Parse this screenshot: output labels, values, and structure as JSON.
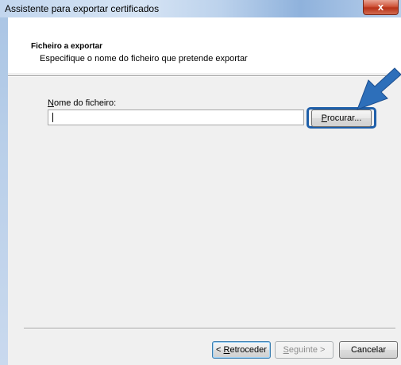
{
  "window": {
    "title": "Assistente para exportar certificados",
    "close_label": "x"
  },
  "header": {
    "title": "Ficheiro a exportar",
    "subtitle": "Especifique o nome do ficheiro que pretende exportar"
  },
  "form": {
    "filename_label_accesskey": "N",
    "filename_label_rest": "ome do ficheiro:",
    "filename_value": "",
    "browse_accesskey": "P",
    "browse_rest": "rocurar..."
  },
  "footer": {
    "back_prefix": "< ",
    "back_accesskey": "R",
    "back_rest": "etroceder",
    "next_accesskey": "S",
    "next_rest": "eguinte >",
    "cancel_label": "Cancelar"
  },
  "colors": {
    "accent": "#1f5fa9",
    "arrow": "#2d6fba",
    "close_button": "#c7432a"
  },
  "icons": {
    "close": "close-icon",
    "pointer": "arrow-pointer-icon"
  }
}
